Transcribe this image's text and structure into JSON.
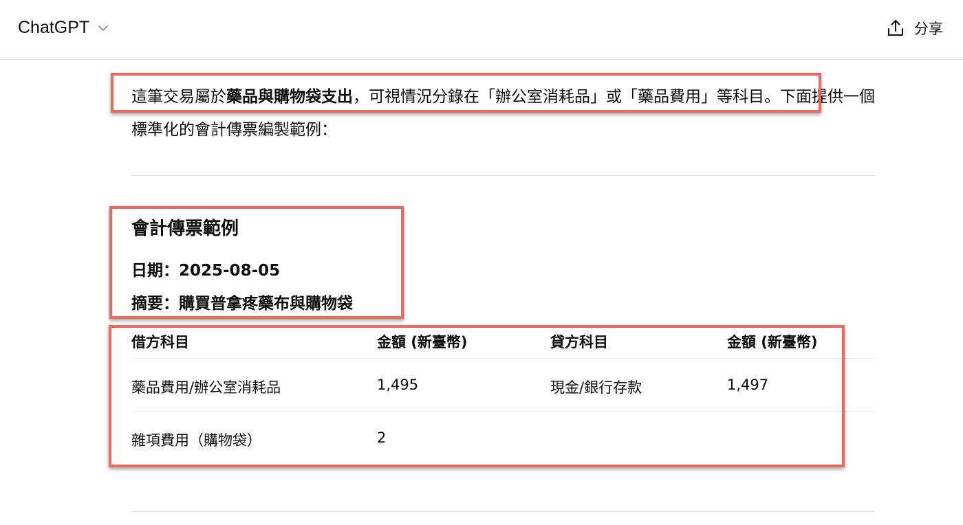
{
  "header": {
    "model_name": "ChatGPT",
    "share_label": "分享"
  },
  "message": {
    "para_before": "這筆交易屬於",
    "para_bold": "藥品與購物袋支出",
    "para_after": "，可視情況分錄在「辦公室消耗品」或「藥品費用」等科目。下面提供一個標準化的會計傳票編製範例：",
    "heading": "會計傳票範例",
    "date_line": "日期：2025-08-05",
    "summary_line": "摘要：購買普拿疼藥布與購物袋"
  },
  "table": {
    "headers": [
      "借方科目",
      "金額 (新臺幣)",
      "貸方科目",
      "金額 (新臺幣)"
    ],
    "rows": [
      [
        "藥品費用/辦公室消耗品",
        "1,495",
        "現金/銀行存款",
        "1,497"
      ],
      [
        "雜項費用（購物袋）",
        "2",
        "",
        ""
      ]
    ]
  },
  "colors": {
    "annotation": "#e86a60",
    "divider": "#dcdcdc"
  }
}
